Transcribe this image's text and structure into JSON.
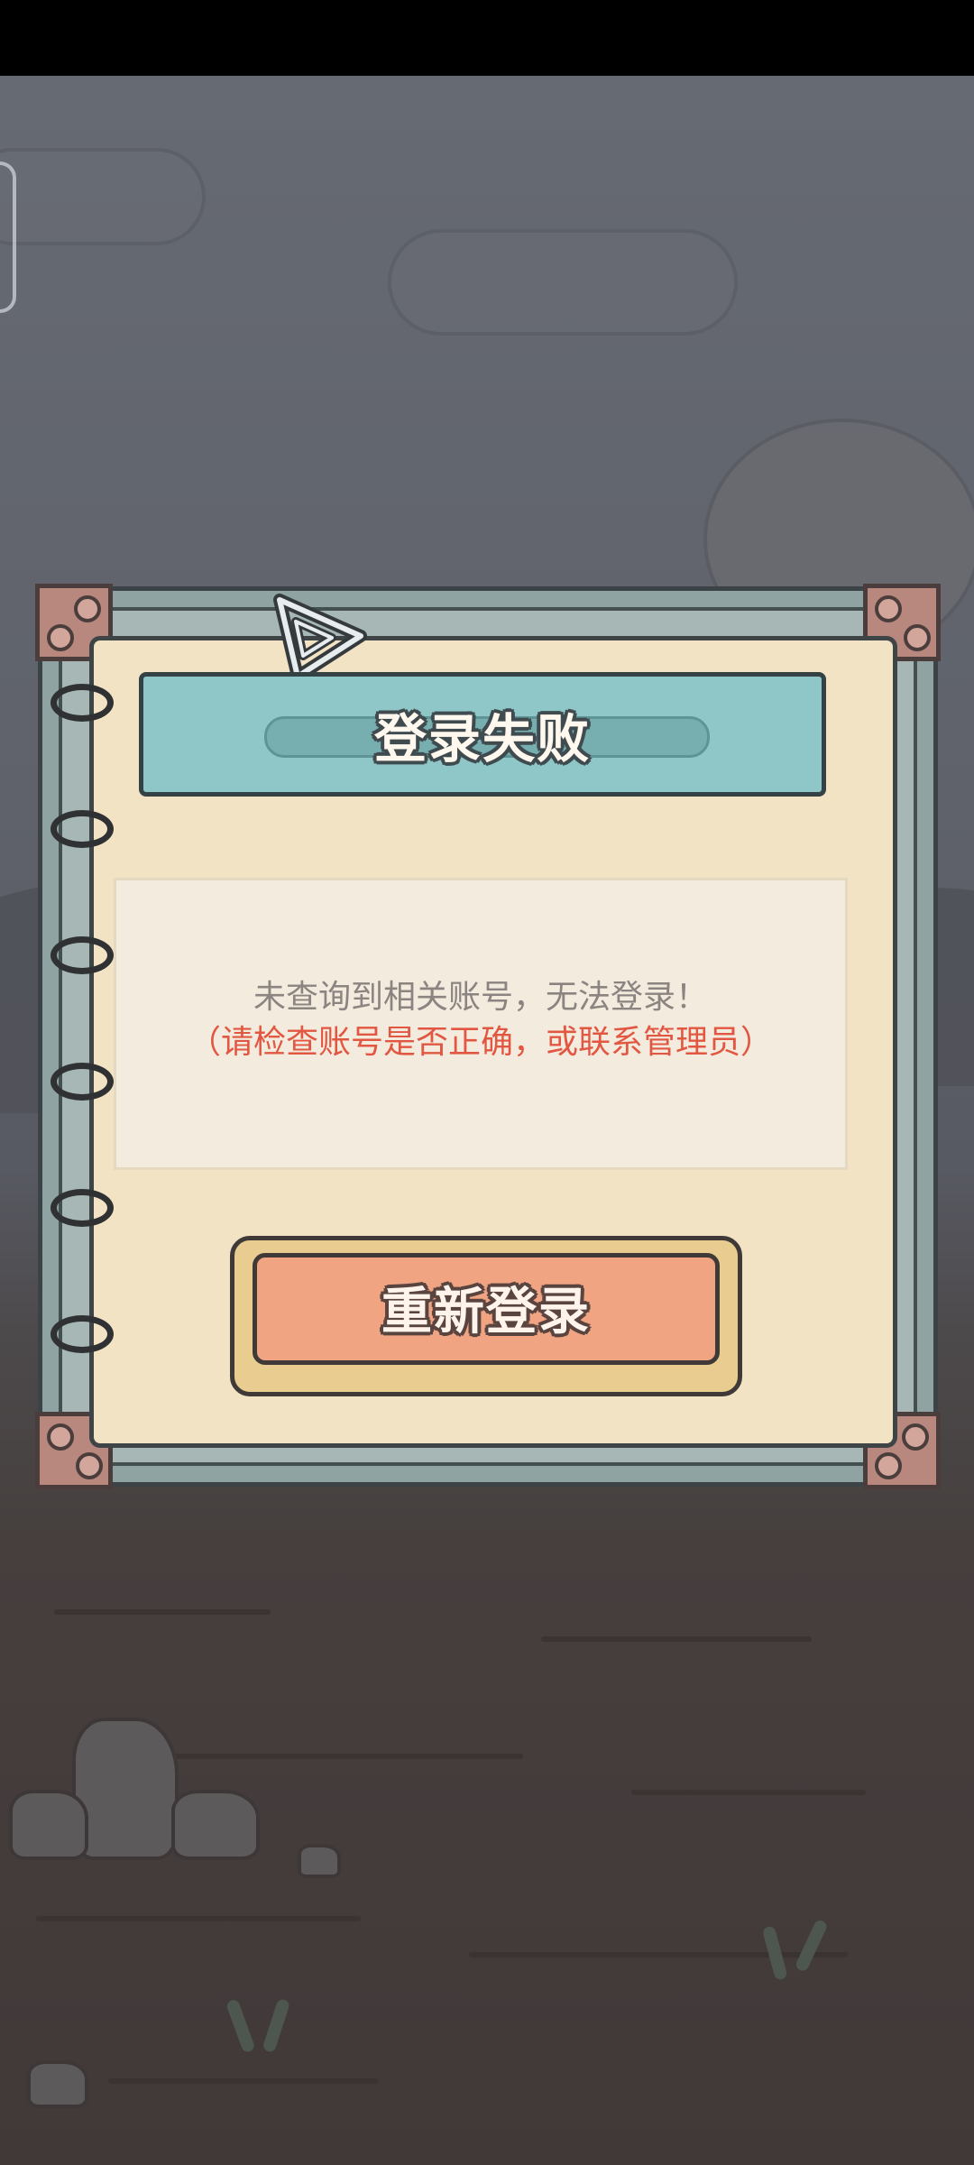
{
  "dialog": {
    "title": "登录失败",
    "message_line_1": "未查询到相关账号，无法登录！",
    "message_line_2": "（请检查账号是否正确，或联系管理员）",
    "relogin_button": "重新登录"
  },
  "colors": {
    "title_banner": "#8fc6c7",
    "paper": "#f3e3c5",
    "error_text": "#e25742",
    "button": "#f0a482"
  },
  "icons": [
    "paperclip-icon",
    "binder-ring-icon",
    "corner-bolt-icon"
  ]
}
